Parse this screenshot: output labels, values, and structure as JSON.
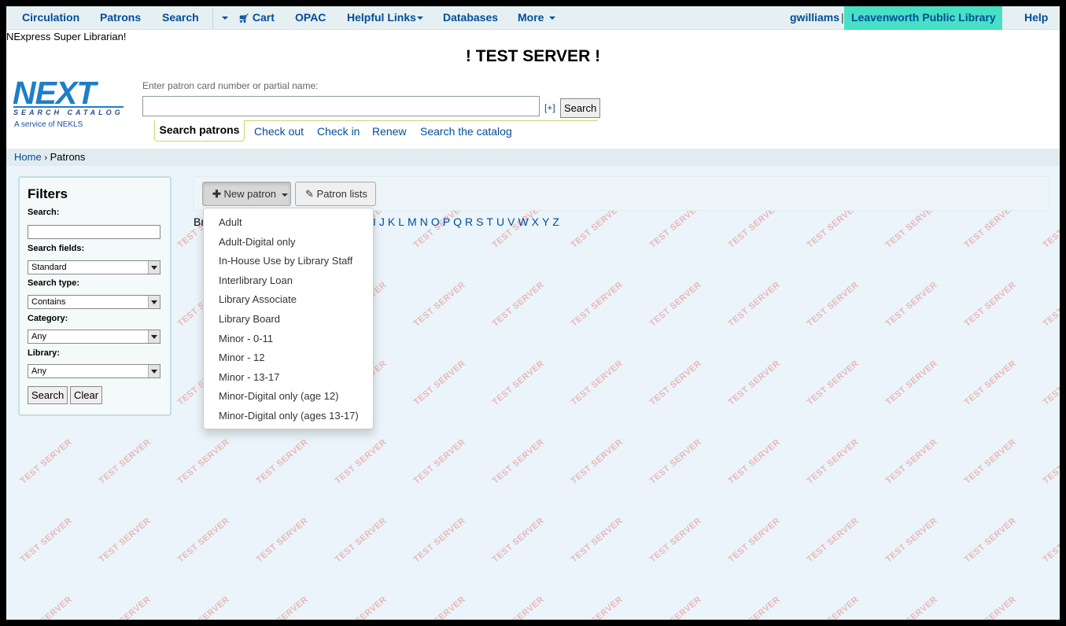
{
  "topnav": {
    "items": [
      {
        "label": "Circulation"
      },
      {
        "label": "Patrons"
      },
      {
        "label": "Search"
      },
      {
        "label": "Cart"
      },
      {
        "label": "OPAC"
      },
      {
        "label": "Helpful Links"
      },
      {
        "label": "Databases"
      },
      {
        "label": "More"
      }
    ],
    "user": "gwilliams",
    "separator": "|",
    "library": "Leavenworth Public Library",
    "help": "Help"
  },
  "header": {
    "login_branch": "NExpress Super Librarian!",
    "test_title": "! TEST SERVER !",
    "logo_text": "NEXT",
    "logo_sub": "SEARCH CATALOG",
    "logo_service": "A service of NEKLS",
    "prompt": "Enter patron card number or partial name:",
    "patron_input_value": "",
    "advanced_toggle": "[+]",
    "search_button": "Search",
    "tabs": [
      "Search patrons",
      "Check out",
      "Check in",
      "Renew",
      "Search the catalog"
    ]
  },
  "breadcrumbs": {
    "home": "Home",
    "separator": "›",
    "current": "Patrons"
  },
  "filters": {
    "title": "Filters",
    "search_label": "Search:",
    "search_value": "",
    "fields_label": "Search fields:",
    "fields_value": "Standard",
    "type_label": "Search type:",
    "type_value": "Contains",
    "category_label": "Category:",
    "category_value": "Any",
    "library_label": "Library:",
    "library_value": "Any",
    "search_button": "Search",
    "clear_button": "Clear"
  },
  "toolbar": {
    "new_patron": "New patron",
    "patron_lists": "Patron lists"
  },
  "alpha": {
    "browse_prefix": "Br",
    "letters": [
      "I",
      "J",
      "K",
      "L",
      "M",
      "N",
      "O",
      "P",
      "Q",
      "R",
      "S",
      "T",
      "U",
      "V",
      "W",
      "X",
      "Y",
      "Z"
    ]
  },
  "new_patron_menu": [
    "Adult",
    "Adult-Digital only",
    "In-House Use by Library Staff",
    "Interlibrary Loan",
    "Library Associate",
    "Library Board",
    "Minor - 0-11",
    "Minor - 12",
    "Minor - 13-17",
    "Minor-Digital only (age 12)",
    "Minor-Digital only (ages 13-17)"
  ],
  "watermark_text": "TEST SERVER",
  "colors": {
    "link": "#004d99",
    "library_highlight": "#48e0c5",
    "background": "#eaf4fa",
    "watermark": "#e8b8b8"
  }
}
